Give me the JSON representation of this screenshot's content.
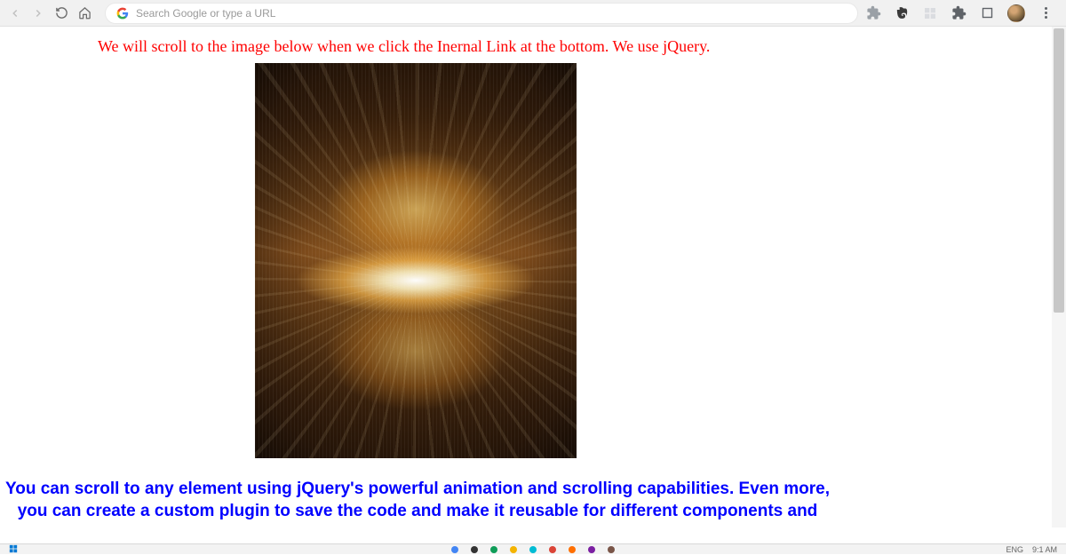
{
  "browser": {
    "address_placeholder": "Search Google or type a URL"
  },
  "page": {
    "heading_red": "We will scroll to the image below when we click the Inernal Link at the bottom. We use jQuery.",
    "paragraph_blue": "You can scroll to any element using jQuery's powerful animation and scrolling capabilities. Even more, you can create a custom plugin to save the code and make it reusable for different components and use cases."
  },
  "taskbar": {
    "lang": "ENG",
    "time": "9:1 AM"
  }
}
